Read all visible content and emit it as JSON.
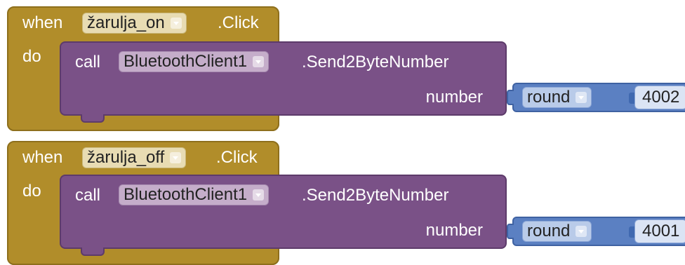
{
  "colors": {
    "event_block": "#b18d2a",
    "call_block": "#7a5187",
    "math_block": "#5b80c2"
  },
  "blocks": [
    {
      "when_label": "when",
      "component": "žarulja_on",
      "event": ".Click",
      "do_label": "do",
      "call": {
        "call_label": "call",
        "component": "BluetoothClient1",
        "method": ".Send2ByteNumber",
        "arg_label": "number",
        "arg": {
          "function": "round",
          "value": "4002"
        }
      }
    },
    {
      "when_label": "when",
      "component": "žarulja_off",
      "event": ".Click",
      "do_label": "do",
      "call": {
        "call_label": "call",
        "component": "BluetoothClient1",
        "method": ".Send2ByteNumber",
        "arg_label": "number",
        "arg": {
          "function": "round",
          "value": "4001"
        }
      }
    }
  ]
}
